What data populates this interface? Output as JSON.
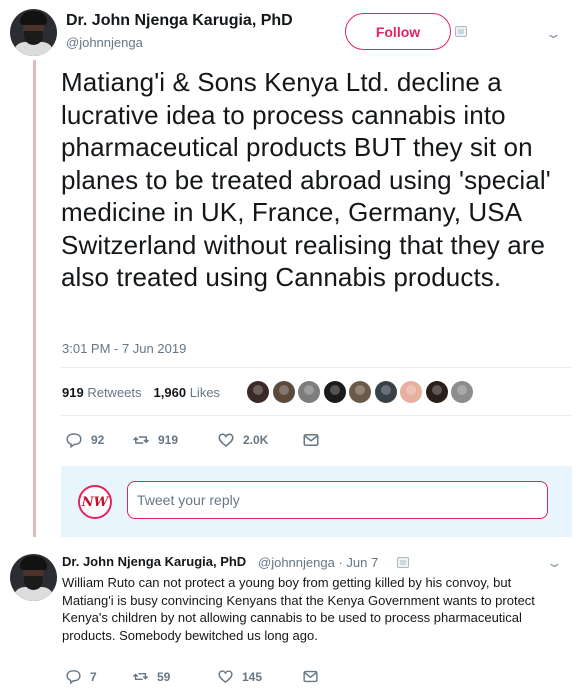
{
  "main_tweet": {
    "author_name": "Dr. John Njenga Karugia, PhD",
    "author_handle": "@johnnjenga",
    "follow_label": "Follow",
    "text": "Matiang'i & Sons Kenya Ltd. decline a lucrative idea to process cannabis into pharmaceutical products BUT they sit on planes to be treated abroad using 'special' medicine in UK, France, Germany, USA Switzerland without realising that they are also treated using Cannabis products.",
    "timestamp": "3:01 PM - 7 Jun 2019",
    "retweets_count": "919",
    "retweets_label": "Retweets",
    "likes_count": "1,960",
    "likes_label": "Likes",
    "liker_avatar_colors": [
      "#3a2a26",
      "#5b4a3c",
      "#7d7d7d",
      "#1a1a1a",
      "#6b5a4a",
      "#384048",
      "#e8b0a0",
      "#2a1f1a",
      "#8c8c8c"
    ],
    "actions": {
      "reply_count": "92",
      "retweet_count": "919",
      "like_count": "2.0K"
    }
  },
  "reply_box": {
    "logo_text": "NW",
    "placeholder": "Tweet your reply"
  },
  "reply_tweet": {
    "author_name": "Dr. John Njenga Karugia, PhD",
    "author_handle": "@johnnjenga",
    "date": "Jun 7",
    "separator": "·",
    "text": "William Ruto can not protect a young boy from getting killed by his convoy, but Matiang'i is busy convincing Kenyans that the Kenya Government wants to protect Kenya's children by not allowing cannabis to be used to process pharmaceutical products. Somebody bewitched us long ago.",
    "actions": {
      "reply_count": "7",
      "retweet_count": "59",
      "like_count": "145"
    }
  },
  "colors": {
    "accent": "#e0245e",
    "thread_line": "#e6b8bd",
    "secondary_text": "#657786",
    "reply_area_bg": "#e8f5fd"
  },
  "icons": [
    "chevron-down-icon",
    "media-icon",
    "reply-icon",
    "retweet-icon",
    "like-icon",
    "direct-message-icon"
  ]
}
